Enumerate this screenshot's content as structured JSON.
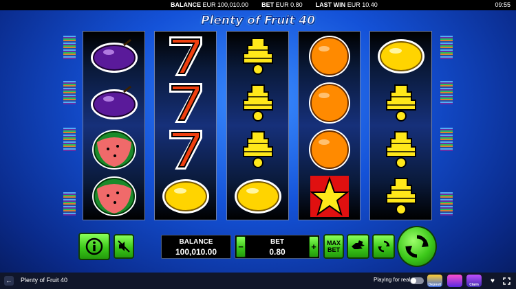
{
  "topbar": {
    "balance_label": "BALANCE",
    "balance_value": "EUR 100,010.00",
    "bet_label": "BET",
    "bet_value": "EUR 0.80",
    "last_win_label": "LAST WIN",
    "last_win_value": "EUR 10.40",
    "clock": "09:55"
  },
  "game": {
    "logo_text": "Plenty of Fruit 40",
    "reels": [
      [
        "plum",
        "plum",
        "watermelon",
        "watermelon"
      ],
      [
        "seven",
        "seven",
        "seven",
        "lemon"
      ],
      [
        "bell",
        "bell",
        "bell",
        "lemon"
      ],
      [
        "orange",
        "orange",
        "orange",
        "star"
      ],
      [
        "lemon",
        "bell",
        "bell",
        "bell"
      ]
    ]
  },
  "controls": {
    "info_icon": "info-icon",
    "mute_icon": "speaker-muted-icon",
    "balance_label": "BALANCE",
    "balance_value": "100,010.00",
    "bet_minus": "−",
    "bet_plus": "+",
    "bet_label": "BET",
    "bet_value": "0.80",
    "max_bet_line1": "MAX",
    "max_bet_line2": "BET",
    "gamble_icon": "gamble-hand-icon",
    "autoplay_icon": "autoplay-icon",
    "spin_icon": "spin-icon"
  },
  "bottombar": {
    "back_icon": "back-arrow-icon",
    "title": "Plenty of Fruit 40",
    "playing_for_real": "Playing for real",
    "promo1": "Deposit",
    "promo2": "",
    "promo3": "Claim",
    "favorite_icon": "heart-icon",
    "fullscreen_icon": "fullscreen-icon"
  },
  "colors": {
    "button_green": "#3cc81a",
    "background_blue": "#1452d8"
  }
}
